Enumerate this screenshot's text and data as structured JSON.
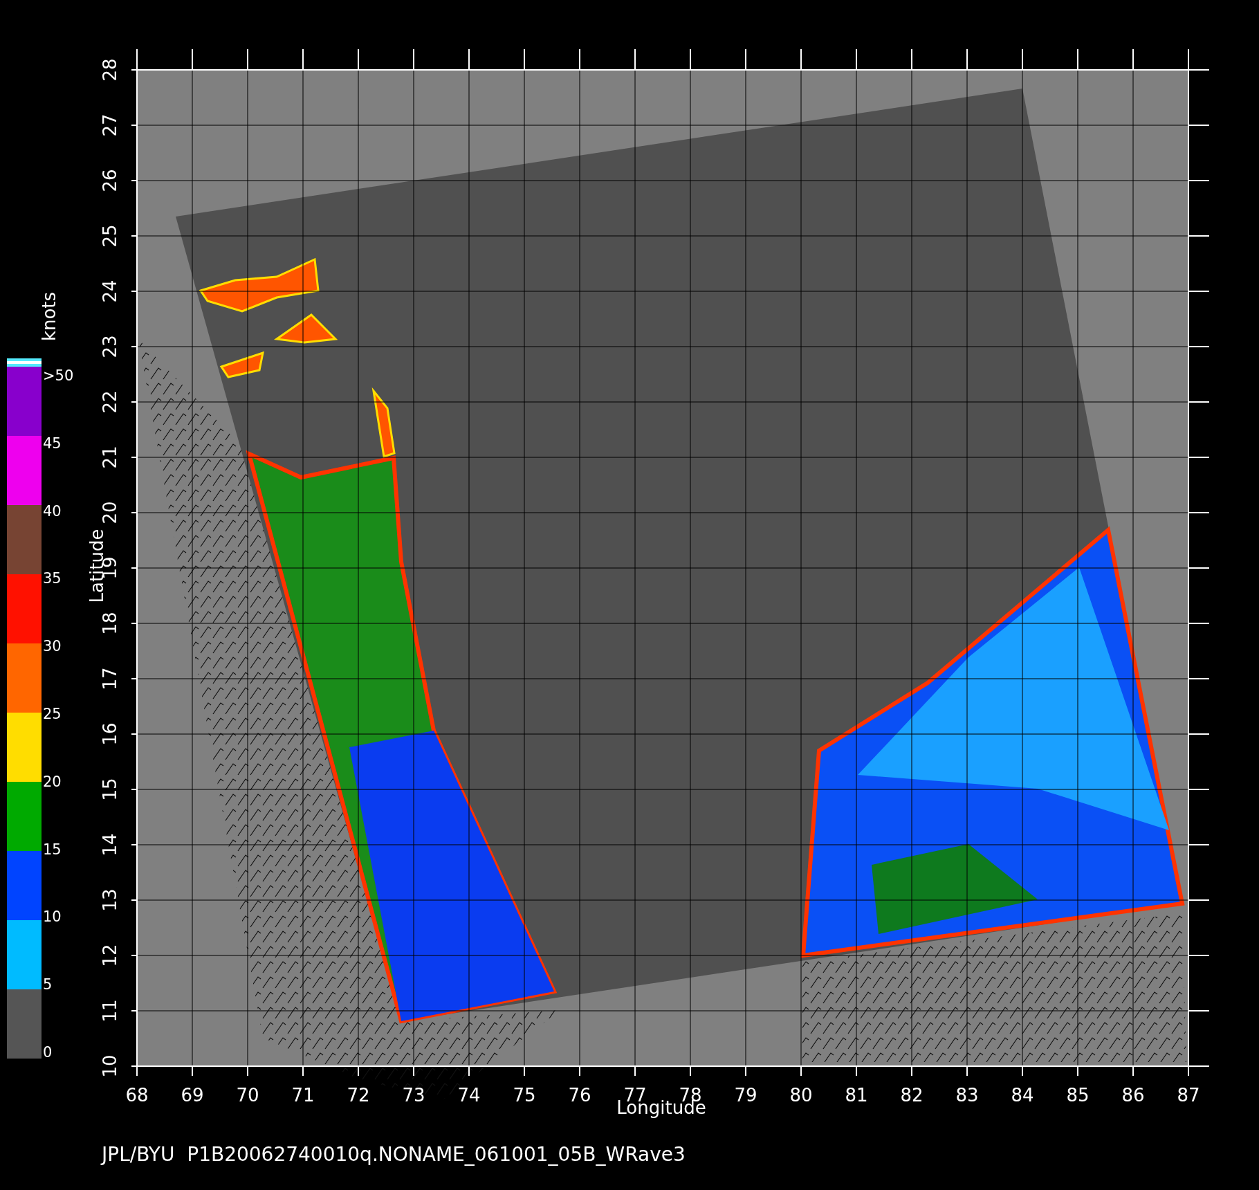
{
  "plot": {
    "xlabel": "Longitude",
    "ylabel": "Latitude",
    "xticks": [
      "68",
      "69",
      "70",
      "71",
      "72",
      "73",
      "74",
      "75",
      "76",
      "77",
      "78",
      "79",
      "80",
      "81",
      "82",
      "83",
      "84",
      "85",
      "86",
      "87"
    ],
    "yticks": [
      "10",
      "11",
      "12",
      "13",
      "14",
      "15",
      "16",
      "17",
      "18",
      "19",
      "20",
      "21",
      "22",
      "23",
      "24",
      "25",
      "26",
      "27",
      "28"
    ]
  },
  "colorbar": {
    "unit": "knots",
    "labels": [
      ">50",
      "45",
      "40",
      "35",
      "30",
      "25",
      "20",
      "15",
      "10",
      "5",
      "0"
    ],
    "segments": [
      {
        "color": "#8800cc"
      },
      {
        "color": "#ee00ee"
      },
      {
        "color": "#774433"
      },
      {
        "color": "#ff1100"
      },
      {
        "color": "#ff6600"
      },
      {
        "color": "#ffdd00"
      },
      {
        "color": "#00aa00"
      },
      {
        "color": "#0044ff"
      },
      {
        "color": "#00bbff"
      },
      {
        "color": "#555555"
      }
    ]
  },
  "footer": "JPL/BYU  P1B20062740010q.NONAME_061001_05B_WRave3"
}
